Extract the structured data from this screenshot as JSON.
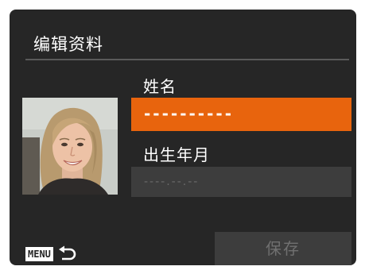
{
  "header": {
    "title": "编辑资料"
  },
  "form": {
    "name_label": "姓名",
    "name_value": "----------",
    "birth_label": "出生年月",
    "birth_placeholder": "----.--.--"
  },
  "footer": {
    "menu_badge": "MENU",
    "back_icon": "return-arrow-icon",
    "save_label": "保存"
  },
  "colors": {
    "background": "#262626",
    "accent": "#e8640d",
    "field_inactive": "#3d3d3d",
    "text": "#ffffff",
    "text_disabled": "#707070"
  }
}
